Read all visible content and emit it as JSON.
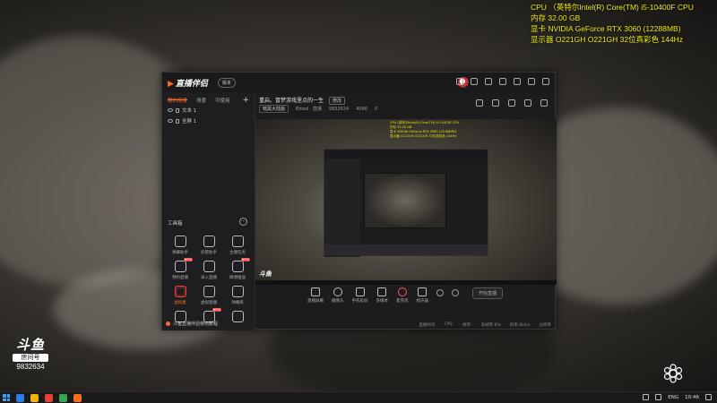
{
  "hw_overlay": {
    "cpu": "CPU （英特尔Intel(R) Core(TM) i5-10400F CPU",
    "ram": "内存  32.00 GB",
    "gpu": "显卡  NVIDIA GeForce RTX 3060 (12288MB)",
    "display": "显示器  O221GH O221GH 32位真彩色 144Hz"
  },
  "watermark": {
    "logo": "斗鱼",
    "sub": "房间号",
    "room_id": "9832634"
  },
  "app": {
    "logo": "直播伴侣",
    "version_badge": "版本",
    "scene_tabs": [
      "我的场景",
      "场景",
      "可使用"
    ],
    "add_scene": "+",
    "sources": [
      {
        "name": "文本 1"
      },
      {
        "name": "全屏 1"
      }
    ],
    "tools_title": "工具箱",
    "tools": [
      {
        "label": "弹幕助手",
        "badge": ""
      },
      {
        "label": "房管助手",
        "badge": ""
      },
      {
        "label": "主播任务",
        "badge": ""
      },
      {
        "label": "预约直播",
        "badge": "NEW"
      },
      {
        "label": "录入直播",
        "badge": ""
      },
      {
        "label": "微博推送",
        "badge": "NEW"
      },
      {
        "label": "虚拟麦",
        "badge": "",
        "active": true
      },
      {
        "label": "虚拟直播",
        "badge": ""
      },
      {
        "label": "弹幕库",
        "badge": ""
      },
      {
        "label": "",
        "badge": ""
      },
      {
        "label": "",
        "badge": "NEW"
      },
      {
        "label": "",
        "badge": ""
      }
    ],
    "notice": "斗鱼直播伴侣使用教程",
    "room_title": "重启。冒梦游戏里点的一生",
    "edit_label": "修改",
    "category_btn": "暗黑大陆版",
    "blood": "Blood · 直播",
    "viewers": "9832634",
    "heat": "4096",
    "fans": "0",
    "preview_overlay": [
      "CPU (英特尔Intel(R) Core(TM) i5-10400F CPU",
      "内存 32.00 GB",
      "显卡 NVIDIA GeForce RTX 3060 (12288MB)",
      "显示器 O221GH O221GH 32位真彩色 144Hz"
    ],
    "preview_brand": "斗鱼",
    "controls": [
      {
        "label": "直播屏幕",
        "icon": "screen-icon"
      },
      {
        "label": "摄像头",
        "icon": "camera-icon"
      },
      {
        "label": "手机投屏",
        "icon": "phone-icon"
      },
      {
        "label": "多媒体",
        "icon": "media-icon"
      },
      {
        "label": "麦克风",
        "icon": "mic-icon"
      },
      {
        "label": "扬声器",
        "icon": "speaker-icon"
      }
    ],
    "start_button": "开始直播",
    "status": [
      "直播时间",
      "CPU:",
      "帧率:",
      "丢帧率:0%",
      "码率:0kb/s",
      "分辨率"
    ]
  },
  "taskbar": {
    "lang": "ENG",
    "time": "10:46",
    "apps": [
      "#2b7de9",
      "#f4b400",
      "#e94235",
      "#34a853",
      "#ff6b1a"
    ]
  }
}
